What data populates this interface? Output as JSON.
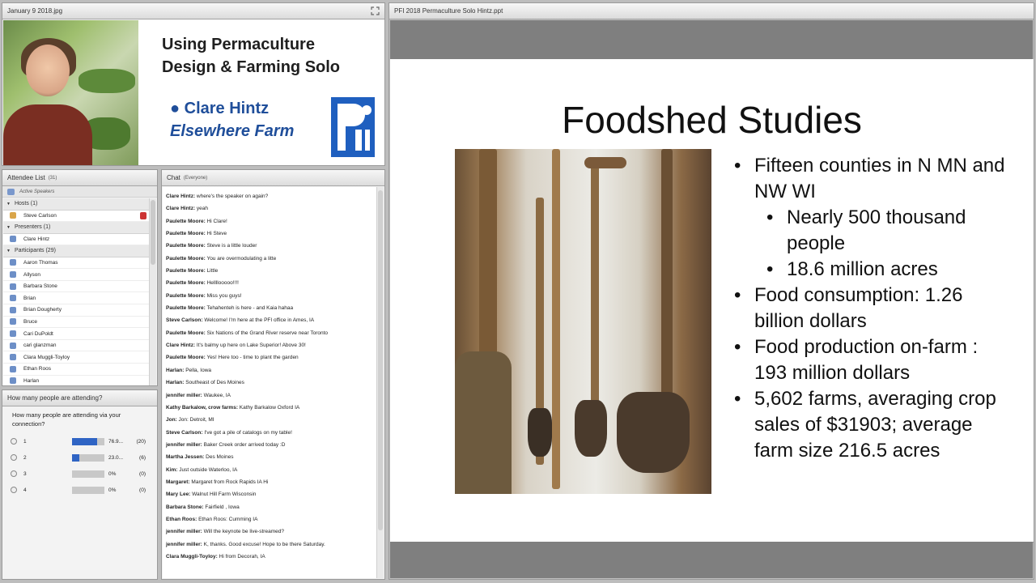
{
  "camera": {
    "title": "January 9 2018.jpg",
    "heading_line1": "Using Permaculture",
    "heading_line2": "Design & Farming Solo",
    "name": "● Clare Hintz",
    "farm": "Elsewhere Farm",
    "logo_icon": "pfi-logo"
  },
  "attendees": {
    "title": "Attendee List",
    "count": "(31)",
    "active_speakers": "Active Speakers",
    "hosts_label": "Hosts (1)",
    "hosts": [
      "Steve Carlson"
    ],
    "presenters_label": "Presenters (1)",
    "presenters": [
      "Clare Hintz"
    ],
    "participants_label": "Participants (29)",
    "participants": [
      "Aaron Thomas",
      "Allyson",
      "Barbara Stone",
      "Brian",
      "Brian Dougherty",
      "Bruce",
      "Cari DuPoldt",
      "cari glanzman",
      "Clara Muggli-Toyloy",
      "Ethan Roos",
      "Harlan"
    ]
  },
  "poll": {
    "title": "How many people are attending?",
    "question": "How many people are attending via your connection?",
    "options": [
      {
        "label": "1",
        "fraction": 0.769,
        "pct": "76.9...",
        "count": "(20)"
      },
      {
        "label": "2",
        "fraction": 0.23,
        "pct": "23.0...",
        "count": "(6)"
      },
      {
        "label": "3",
        "fraction": 0,
        "pct": "0%",
        "count": "(0)"
      },
      {
        "label": "4",
        "fraction": 0,
        "pct": "0%",
        "count": "(0)"
      }
    ]
  },
  "chat": {
    "title": "Chat",
    "scope": "(Everyone)",
    "messages": [
      {
        "who": "Clare Hintz:",
        "text": " where's the speaker on again?"
      },
      {
        "who": "Clare Hintz:",
        "text": " yeah"
      },
      {
        "who": "Paulette Moore:",
        "text": " Hi Clare!"
      },
      {
        "who": "Paulette Moore:",
        "text": " Hi Steve"
      },
      {
        "who": "Paulette Moore:",
        "text": " Steve is a little louder"
      },
      {
        "who": "Paulette Moore:",
        "text": " You are overmodulating a litte"
      },
      {
        "who": "Paulette Moore:",
        "text": " Little"
      },
      {
        "who": "Paulette Moore:",
        "text": " Hellllooooo!!!!"
      },
      {
        "who": "Paulette Moore:",
        "text": " Miss you guys!"
      },
      {
        "who": "Paulette Moore:",
        "text": " Tehahenteh is here - and Kaia hahaa"
      },
      {
        "who": "Steve Carlson:",
        "text": " Welcome! I'm here at the PFI office in Ames, IA"
      },
      {
        "who": "Paulette Moore:",
        "text": " Six Nations of the Grand River reserve near Toronto"
      },
      {
        "who": "Clare Hintz:",
        "text": " It's balmy up here on Lake Superior! Above 30!"
      },
      {
        "who": "Paulette Moore:",
        "text": " Yes! Here too - time to plant the garden"
      },
      {
        "who": "Harlan:",
        "text": " Pella, Iowa"
      },
      {
        "who": "Harlan:",
        "text": " Southeast of Des Moines"
      },
      {
        "who": "jennifer miller:",
        "text": " Waukee, IA"
      },
      {
        "who": "Kathy Barkalow, crow farms:",
        "text": " Kathy Barkalow Oxford IA"
      },
      {
        "who": "Jon:",
        "text": " Jon: Detroit, MI"
      },
      {
        "who": "Steve Carlson:",
        "text": " I've got a pile of catalogs on my table!"
      },
      {
        "who": "jennifer miller:",
        "text": " Baker Creek order arrived today :D"
      },
      {
        "who": "Martha Jessen:",
        "text": " Des Moines"
      },
      {
        "who": "Kim:",
        "text": " Just outside Waterloo, IA"
      },
      {
        "who": "Margaret:",
        "text": " Margaret from Rock Rapids IA Hi"
      },
      {
        "who": "Mary Lee:",
        "text": " Walnut Hill Farm Wisconsin"
      },
      {
        "who": "Barbara Stone:",
        "text": " Fairfield , Iowa"
      },
      {
        "who": "Ethan Roos:",
        "text": " Ethan Roos: Cumming IA"
      },
      {
        "who": "jennifer miller:",
        "text": " Will the keynote be live-streamed?"
      },
      {
        "who": "jennifer miller:",
        "text": " K, thanks. Good excuse! Hope to be there Saturday."
      },
      {
        "who": "Clara Muggli-Toyloy:",
        "text": " Hi from Decorah, IA"
      }
    ]
  },
  "slide": {
    "pod_title": "PFI 2018 Permaculture Solo Hintz.ppt",
    "title": "Foodshed Studies",
    "bullets": [
      {
        "level": 1,
        "text": "Fifteen counties in N MN and NW WI"
      },
      {
        "level": 2,
        "text": "Nearly 500 thousand people"
      },
      {
        "level": 2,
        "text": "18.6 million acres"
      },
      {
        "level": 1,
        "text": "Food consumption: 1.26 billion dollars"
      },
      {
        "level": 1,
        "text": "Food production on-farm : 193 million dollars"
      },
      {
        "level": 1,
        "text": "5,602 farms, averaging crop sales of $31903; average farm size 216.5 acres"
      }
    ]
  },
  "colors": {
    "accent_blue": "#2f64c4",
    "pfi_blue": "#1f5fbf",
    "slide_frame": "#7f7f7f"
  }
}
